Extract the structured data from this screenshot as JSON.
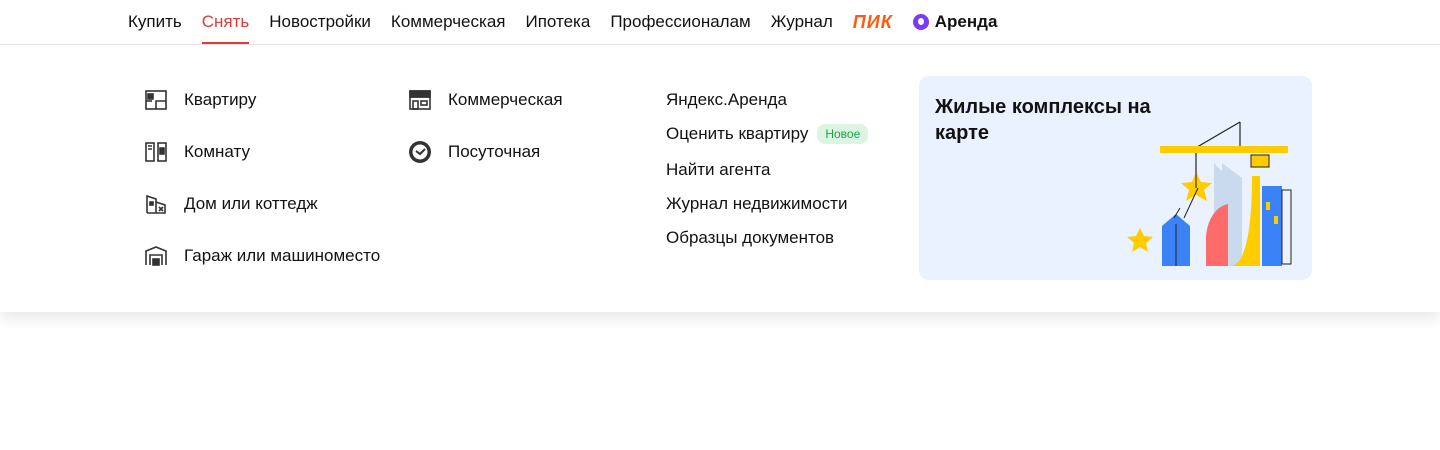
{
  "topnav": {
    "items": [
      {
        "label": "Купить",
        "active": false
      },
      {
        "label": "Снять",
        "active": true
      },
      {
        "label": "Новостройки",
        "active": false
      },
      {
        "label": "Коммерческая",
        "active": false
      },
      {
        "label": "Ипотека",
        "active": false
      },
      {
        "label": "Профессионалам",
        "active": false
      },
      {
        "label": "Журнал",
        "active": false
      }
    ],
    "pik_logo": "ПИК",
    "arenda_logo": "Аренда",
    "accent_color": "#e03a3a"
  },
  "dropdown": {
    "col1": [
      {
        "label": "Квартиру",
        "icon": "apartment-icon"
      },
      {
        "label": "Комнату",
        "icon": "room-icon"
      },
      {
        "label": "Дом или коттедж",
        "icon": "house-icon"
      },
      {
        "label": "Гараж или машиноместо",
        "icon": "garage-icon"
      }
    ],
    "col2": [
      {
        "label": "Коммерческая",
        "icon": "commercial-icon"
      },
      {
        "label": "Посуточная",
        "icon": "clock-icon"
      }
    ],
    "links": [
      {
        "label": "Яндекс.Аренда"
      },
      {
        "label": "Оценить квартиру",
        "badge": "Новое"
      },
      {
        "label": "Найти агента"
      },
      {
        "label": "Журнал недвижимости"
      },
      {
        "label": "Образцы документов"
      }
    ],
    "promo": {
      "title": "Жилые комплексы на карте"
    }
  }
}
